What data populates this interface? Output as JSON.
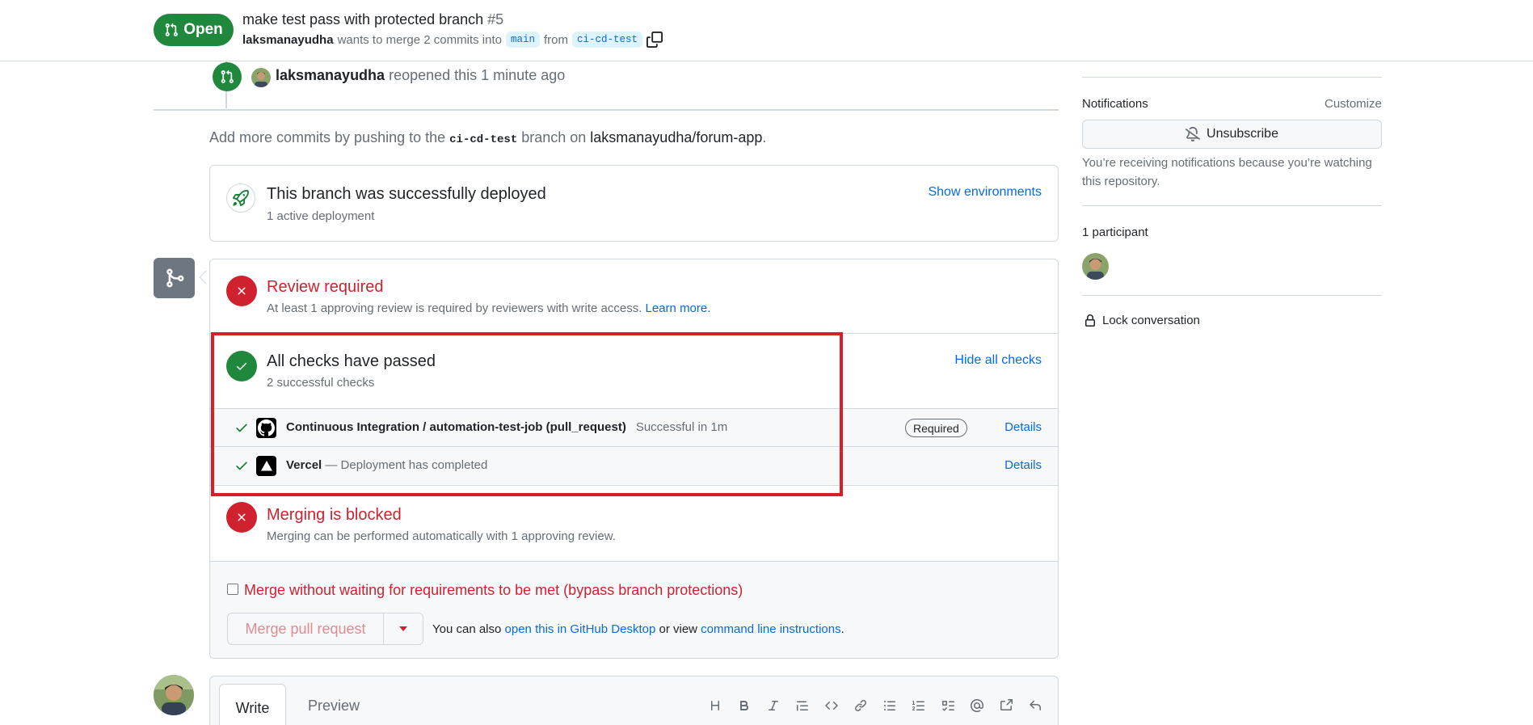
{
  "header": {
    "state_label": "Open",
    "title": "make test pass with protected branch",
    "number": "#5",
    "author": "laksmanayudha",
    "merge_text_1": "wants to merge 2 commits into",
    "base_branch": "main",
    "merge_text_2": "from",
    "head_branch": "ci-cd-test"
  },
  "timeline": {
    "event_user": "laksmanayudha",
    "event_text": "reopened this 1 minute ago",
    "hint_prefix": "Add more commits by pushing to the",
    "hint_branch": "ci-cd-test",
    "hint_middle": "branch on",
    "hint_repo": "laksmanayudha/forum-app",
    "hint_suffix": "."
  },
  "deployment": {
    "title": "This branch was successfully deployed",
    "subtitle": "1 active deployment",
    "show_envs": "Show environments"
  },
  "mergebox": {
    "review_title": "Review required",
    "review_text": "At least 1 approving review is required by reviewers with write access.",
    "learn_more": "Learn more.",
    "checks_title": "All checks have passed",
    "checks_sub": "2 successful checks",
    "hide_checks": "Hide all checks",
    "checks": [
      {
        "name": "Continuous Integration / automation-test-job (pull_request)",
        "status": "Successful in 1m",
        "required": "Required",
        "details": "Details"
      },
      {
        "name": "Vercel",
        "status": "— Deployment has completed",
        "details": "Details"
      }
    ],
    "blocked_title": "Merging is blocked",
    "blocked_text": "Merging can be performed automatically with 1 approving review.",
    "bypass_label": "Merge without waiting for requirements to be met (bypass branch protections)",
    "merge_button": "Merge pull request",
    "also_prefix": "You can also",
    "also_link1": "open this in GitHub Desktop",
    "also_middle": "or view",
    "also_link2": "command line instructions",
    "also_suffix": "."
  },
  "comment": {
    "tab_write": "Write",
    "tab_preview": "Preview"
  },
  "sidebar": {
    "notifications_label": "Notifications",
    "customize": "Customize",
    "unsubscribe": "Unsubscribe",
    "notif_reason": "You’re receiving notifications because you’re watching this repository.",
    "participants_label": "1 participant",
    "lock": "Lock conversation"
  },
  "colors": {
    "open_green": "#1f883d",
    "danger_red": "#cf222e",
    "link_blue": "#0969da",
    "highlight_red": "#d91e2a"
  }
}
